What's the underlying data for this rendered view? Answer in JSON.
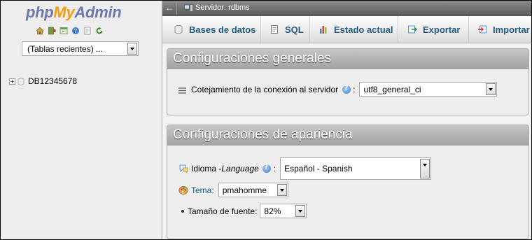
{
  "nav": {
    "logo": {
      "php": "php",
      "my": "My",
      "admin": "Admin"
    },
    "icons": [
      "home-icon",
      "exit-icon",
      "query-window-icon",
      "docs-icon",
      "phpmyadmin-docs-icon",
      "reload-icon"
    ],
    "recent_tables": {
      "value": "(Tablas recientes) ..."
    },
    "databases": [
      {
        "name": "DB12345678"
      }
    ]
  },
  "topbar": {
    "server_label": "Servidor: rdbms"
  },
  "tabs": [
    {
      "label": "Bases de datos",
      "icon": "databases-icon"
    },
    {
      "label": "SQL",
      "icon": "sql-icon"
    },
    {
      "label": "Estado actual",
      "icon": "status-icon"
    },
    {
      "label": "Exportar",
      "icon": "export-icon"
    },
    {
      "label": "Importar",
      "icon": "import-icon"
    }
  ],
  "general": {
    "title": "Configuraciones generales",
    "collation_label": "Cotejamiento de la conexión al servidor",
    "collation_colon": ":",
    "collation_value": "utf8_general_ci"
  },
  "appearance": {
    "title": "Configuraciones de apariencia",
    "language_label": "Idioma - ",
    "language_label_italic": "Language",
    "language_colon": ":",
    "language_value": "Español - Spanish",
    "theme_label": "Tema:",
    "theme_value": "pmahomme",
    "font_size_label": "Tamaño de fuente:",
    "font_size_value": "82%"
  },
  "colors": {
    "link": "#235a81",
    "logo_blue": "#6c78af",
    "logo_orange": "#f89c0e",
    "legend_bg": "#a9a9a9"
  }
}
